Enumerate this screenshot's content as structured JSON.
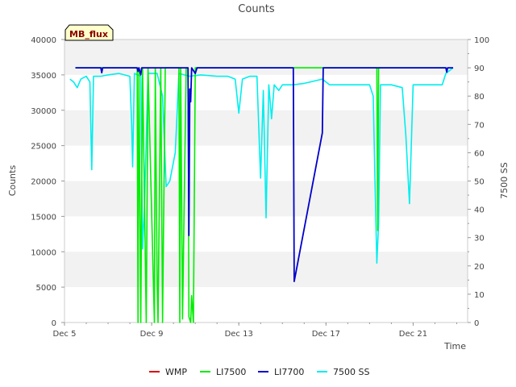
{
  "badge": "MB_flux",
  "chart_data": {
    "type": "line",
    "title": "Counts",
    "xlabel": "Time",
    "ylabel": "Counts",
    "y2label": "7500 SS",
    "x_range": [
      "2023-12-05",
      "2023-12-23T12:00"
    ],
    "ylim": [
      0,
      40000
    ],
    "y2lim": [
      0,
      100
    ],
    "x_ticks": [
      {
        "date": "2023-12-05",
        "label": "Dec 5"
      },
      {
        "date": "2023-12-09",
        "label": "Dec 9"
      },
      {
        "date": "2023-12-13",
        "label": "Dec 13"
      },
      {
        "date": "2023-12-17",
        "label": "Dec 17"
      },
      {
        "date": "2023-12-21",
        "label": "Dec 21"
      }
    ],
    "y_ticks": [
      0,
      5000,
      10000,
      15000,
      20000,
      25000,
      30000,
      35000,
      40000
    ],
    "y2_ticks": [
      0,
      10,
      20,
      30,
      40,
      50,
      60,
      70,
      80,
      90,
      100
    ],
    "grid": "horizontal bands",
    "legend_position": "bottom",
    "series": [
      {
        "name": "WMP",
        "color": "#dd0000",
        "axis": "left",
        "points": []
      },
      {
        "name": "LI7500",
        "color": "#00ee00",
        "axis": "left",
        "points": [
          [
            "2023-12-05 12:00",
            36000
          ],
          [
            "2023-12-08 08:00",
            36000
          ],
          [
            "2023-12-08 09:00",
            0
          ],
          [
            "2023-12-08 10:00",
            36000
          ],
          [
            "2023-12-08 12:00",
            0
          ],
          [
            "2023-12-08 14:00",
            36000
          ],
          [
            "2023-12-08 18:00",
            0
          ],
          [
            "2023-12-08 20:00",
            36000
          ],
          [
            "2023-12-09 03:00",
            0
          ],
          [
            "2023-12-09 04:00",
            36000
          ],
          [
            "2023-12-09 06:00",
            5800
          ],
          [
            "2023-12-09 07:00",
            0
          ],
          [
            "2023-12-09 10:00",
            36000
          ],
          [
            "2023-12-09 12:00",
            0
          ],
          [
            "2023-12-09 15:00",
            36000
          ],
          [
            "2023-12-10 06:00",
            36000
          ],
          [
            "2023-12-10 07:00",
            0
          ],
          [
            "2023-12-10 08:00",
            36000
          ],
          [
            "2023-12-10 10:00",
            500
          ],
          [
            "2023-12-10 14:00",
            36000
          ],
          [
            "2023-12-10 16:00",
            36000
          ],
          [
            "2023-12-10 17:00",
            800
          ],
          [
            "2023-12-10 19:00",
            0
          ],
          [
            "2023-12-10 20:00",
            3800
          ],
          [
            "2023-12-10 22:00",
            0
          ],
          [
            "2023-12-11 00:00",
            36000
          ],
          [
            "2023-12-19 08:00",
            36000
          ],
          [
            "2023-12-19 09:00",
            13000
          ],
          [
            "2023-12-19 10:00",
            36000
          ],
          [
            "2023-12-22 12:00",
            36000
          ]
        ]
      },
      {
        "name": "LI7700",
        "color": "#0000cc",
        "axis": "left",
        "points": [
          [
            "2023-12-05 12:00",
            36000
          ],
          [
            "2023-12-06 16:00",
            36000
          ],
          [
            "2023-12-06 17:00",
            35300
          ],
          [
            "2023-12-06 18:00",
            36000
          ],
          [
            "2023-12-08 08:00",
            36000
          ],
          [
            "2023-12-08 09:00",
            35500
          ],
          [
            "2023-12-08 10:00",
            36000
          ],
          [
            "2023-12-08 12:00",
            35000
          ],
          [
            "2023-12-08 13:00",
            36000
          ],
          [
            "2023-12-10 16:00",
            36000
          ],
          [
            "2023-12-10 17:00",
            12300
          ],
          [
            "2023-12-10 18:00",
            33000
          ],
          [
            "2023-12-10 19:00",
            31200
          ],
          [
            "2023-12-10 20:00",
            36000
          ],
          [
            "2023-12-11 00:00",
            35200
          ],
          [
            "2023-12-11 02:00",
            36000
          ],
          [
            "2023-12-15 12:00",
            36000
          ],
          [
            "2023-12-15 13:00",
            5800
          ],
          [
            "2023-12-16 20:00",
            26800
          ],
          [
            "2023-12-16 21:00",
            36000
          ],
          [
            "2023-12-22 12:00",
            36000
          ],
          [
            "2023-12-22 13:00",
            35400
          ],
          [
            "2023-12-22 14:00",
            36000
          ],
          [
            "2023-12-22 20:00",
            36000
          ]
        ]
      },
      {
        "name": "7500 SS",
        "color": "#00eeee",
        "axis": "right",
        "points": [
          [
            "2023-12-05 06:00",
            86
          ],
          [
            "2023-12-05 10:00",
            85
          ],
          [
            "2023-12-05 14:00",
            83
          ],
          [
            "2023-12-05 18:00",
            86
          ],
          [
            "2023-12-06 00:00",
            87
          ],
          [
            "2023-12-06 04:00",
            85
          ],
          [
            "2023-12-06 06:00",
            54
          ],
          [
            "2023-12-06 08:00",
            87
          ],
          [
            "2023-12-06 16:00",
            87
          ],
          [
            "2023-12-07 00:00",
            87.5
          ],
          [
            "2023-12-07 12:00",
            88
          ],
          [
            "2023-12-08 00:00",
            87
          ],
          [
            "2023-12-08 02:00",
            70
          ],
          [
            "2023-12-08 03:00",
            55
          ],
          [
            "2023-12-08 05:00",
            88
          ],
          [
            "2023-12-08 12:00",
            87
          ],
          [
            "2023-12-08 14:00",
            26
          ],
          [
            "2023-12-08 16:00",
            40
          ],
          [
            "2023-12-08 20:00",
            88
          ],
          [
            "2023-12-09 06:00",
            88
          ],
          [
            "2023-12-09 12:00",
            80
          ],
          [
            "2023-12-09 16:00",
            48
          ],
          [
            "2023-12-09 20:00",
            50
          ],
          [
            "2023-12-10 02:00",
            60
          ],
          [
            "2023-12-10 06:00",
            88
          ],
          [
            "2023-12-10 18:00",
            87
          ],
          [
            "2023-12-11 06:00",
            87.5
          ],
          [
            "2023-12-12 00:00",
            87
          ],
          [
            "2023-12-12 12:00",
            87
          ],
          [
            "2023-12-12 20:00",
            86
          ],
          [
            "2023-12-13 00:00",
            74
          ],
          [
            "2023-12-13 04:00",
            86
          ],
          [
            "2023-12-13 12:00",
            87
          ],
          [
            "2023-12-13 20:00",
            87
          ],
          [
            "2023-12-14 00:00",
            51
          ],
          [
            "2023-12-14 03:00",
            82
          ],
          [
            "2023-12-14 06:00",
            37
          ],
          [
            "2023-12-14 09:00",
            84
          ],
          [
            "2023-12-14 12:00",
            72
          ],
          [
            "2023-12-14 15:00",
            84
          ],
          [
            "2023-12-14 20:00",
            82
          ],
          [
            "2023-12-15 00:00",
            84
          ],
          [
            "2023-12-15 12:00",
            84
          ],
          [
            "2023-12-16 00:00",
            84.5
          ],
          [
            "2023-12-16 20:00",
            86
          ],
          [
            "2023-12-17 04:00",
            84
          ],
          [
            "2023-12-18 00:00",
            84
          ],
          [
            "2023-12-19 00:00",
            84
          ],
          [
            "2023-12-19 04:00",
            80
          ],
          [
            "2023-12-19 06:00",
            50
          ],
          [
            "2023-12-19 08:00",
            21
          ],
          [
            "2023-12-19 10:00",
            35
          ],
          [
            "2023-12-19 12:00",
            84
          ],
          [
            "2023-12-20 00:00",
            84
          ],
          [
            "2023-12-20 12:00",
            83
          ],
          [
            "2023-12-20 16:00",
            66
          ],
          [
            "2023-12-20 20:00",
            42
          ],
          [
            "2023-12-21 00:00",
            84
          ],
          [
            "2023-12-22 00:00",
            84
          ],
          [
            "2023-12-22 08:00",
            84
          ],
          [
            "2023-12-22 12:00",
            88
          ],
          [
            "2023-12-22 20:00",
            90
          ]
        ]
      }
    ]
  }
}
